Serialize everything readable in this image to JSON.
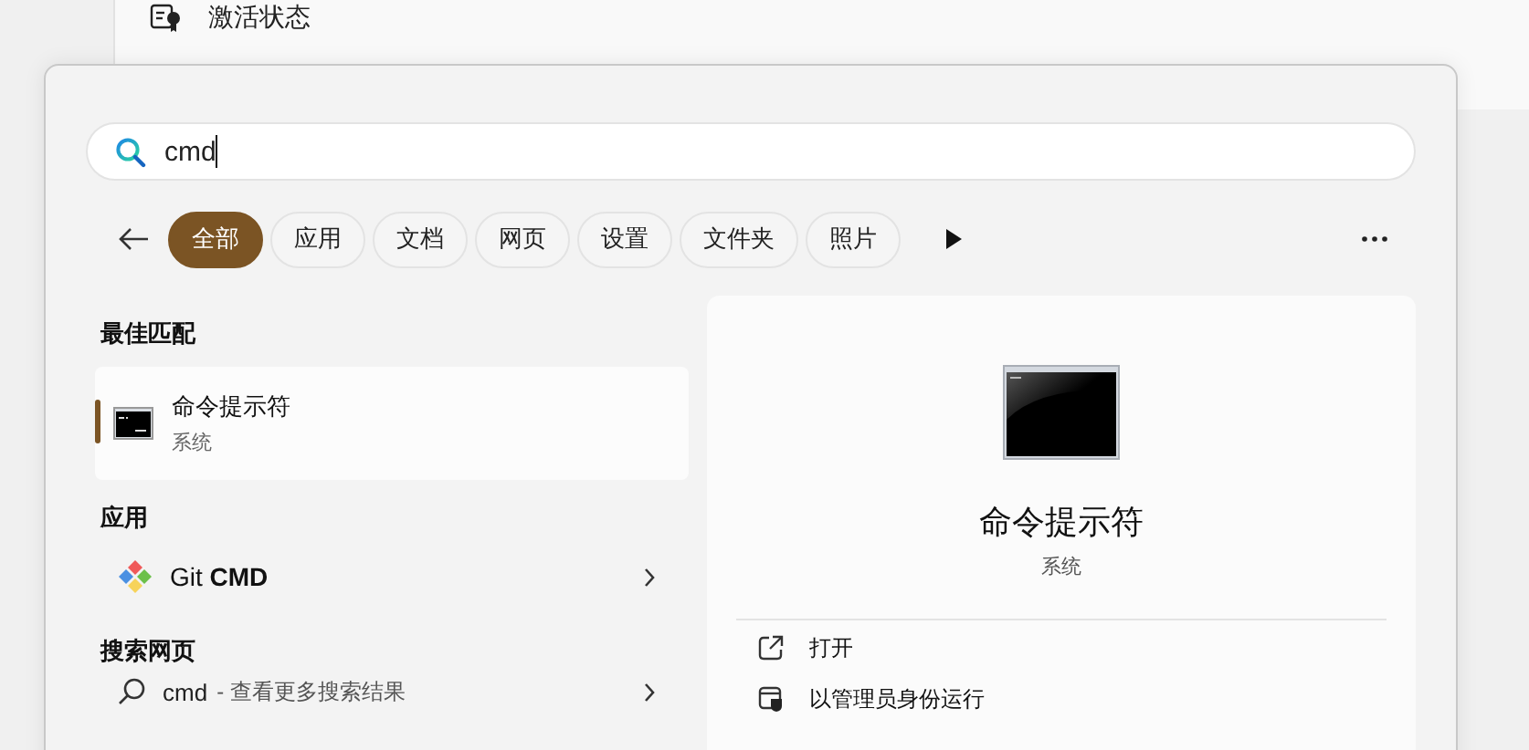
{
  "background_item": {
    "label": "激活状态"
  },
  "search": {
    "value": "cmd"
  },
  "filters": [
    {
      "label": "全部",
      "selected": true
    },
    {
      "label": "应用",
      "selected": false
    },
    {
      "label": "文档",
      "selected": false
    },
    {
      "label": "网页",
      "selected": false
    },
    {
      "label": "设置",
      "selected": false
    },
    {
      "label": "文件夹",
      "selected": false
    },
    {
      "label": "照片",
      "selected": false
    }
  ],
  "sections": [
    {
      "title": "最佳匹配",
      "items": [
        {
          "kind": "best",
          "name": "命令提示符",
          "subtitle": "系统",
          "selected": true
        }
      ]
    },
    {
      "title": "应用",
      "items": [
        {
          "kind": "app",
          "name": "Git **CMD**",
          "selected": false
        }
      ]
    },
    {
      "title": "搜索网页",
      "items": [
        {
          "kind": "web",
          "name": "cmd",
          "hint": "- 查看更多搜索结果",
          "selected": false
        }
      ]
    }
  ],
  "details": {
    "name": "命令提示符",
    "subtitle": "系统",
    "actions": [
      {
        "kind": "open",
        "label": "打开"
      },
      {
        "kind": "admin",
        "label": "以管理员身份运行"
      }
    ]
  }
}
